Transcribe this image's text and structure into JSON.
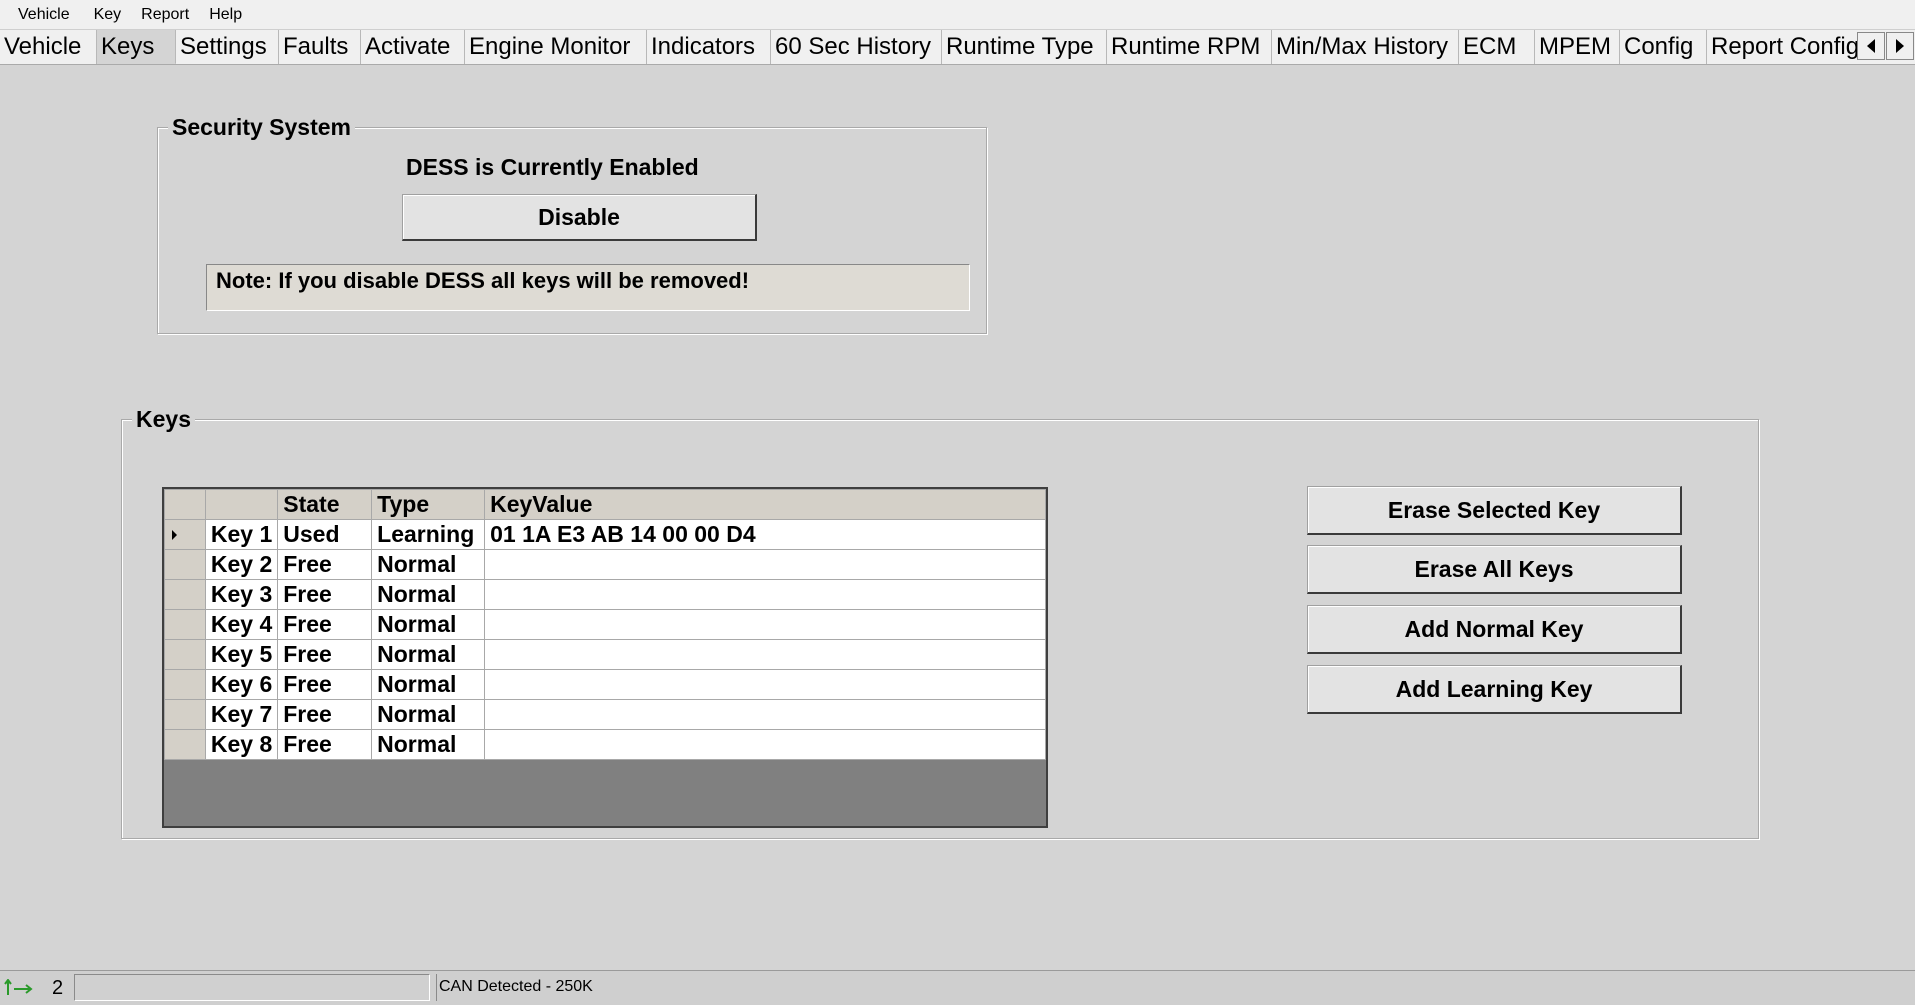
{
  "menu": [
    "Vehicle",
    "Key",
    "Report",
    "Help"
  ],
  "tabs": [
    "Vehicle",
    "Keys",
    "Settings",
    "Faults",
    "Activate",
    "Engine Monitor",
    "Indicators",
    "60 Sec History",
    "Runtime Type",
    "Runtime RPM",
    "Min/Max History",
    "ECM",
    "MPEM",
    "Config",
    "Report Config"
  ],
  "active_tab": "Keys",
  "security": {
    "title": "Security System",
    "status": "DESS is Currently Enabled",
    "disable_label": "Disable",
    "note": "Note: If you disable DESS all keys will be removed!"
  },
  "keys": {
    "title": "Keys",
    "columns": [
      "",
      "State",
      "Type",
      "KeyValue"
    ],
    "rows": [
      {
        "name": "Key 1",
        "state": "Used",
        "type": "Learning",
        "value": "01 1A E3 AB 14 00 00 D4"
      },
      {
        "name": "Key 2",
        "state": "Free",
        "type": "Normal",
        "value": ""
      },
      {
        "name": "Key 3",
        "state": "Free",
        "type": "Normal",
        "value": ""
      },
      {
        "name": "Key 4",
        "state": "Free",
        "type": "Normal",
        "value": ""
      },
      {
        "name": "Key 5",
        "state": "Free",
        "type": "Normal",
        "value": ""
      },
      {
        "name": "Key 6",
        "state": "Free",
        "type": "Normal",
        "value": ""
      },
      {
        "name": "Key 7",
        "state": "Free",
        "type": "Normal",
        "value": ""
      },
      {
        "name": "Key 8",
        "state": "Free",
        "type": "Normal",
        "value": ""
      }
    ],
    "buttons": {
      "erase_selected": "Erase Selected  Key",
      "erase_all": "Erase All Keys",
      "add_normal": "Add Normal Key",
      "add_learning": "Add Learning Key"
    }
  },
  "statusbar": {
    "count": "2",
    "message": "CAN Detected - 250K",
    "icon": "connection-arrows-icon"
  }
}
